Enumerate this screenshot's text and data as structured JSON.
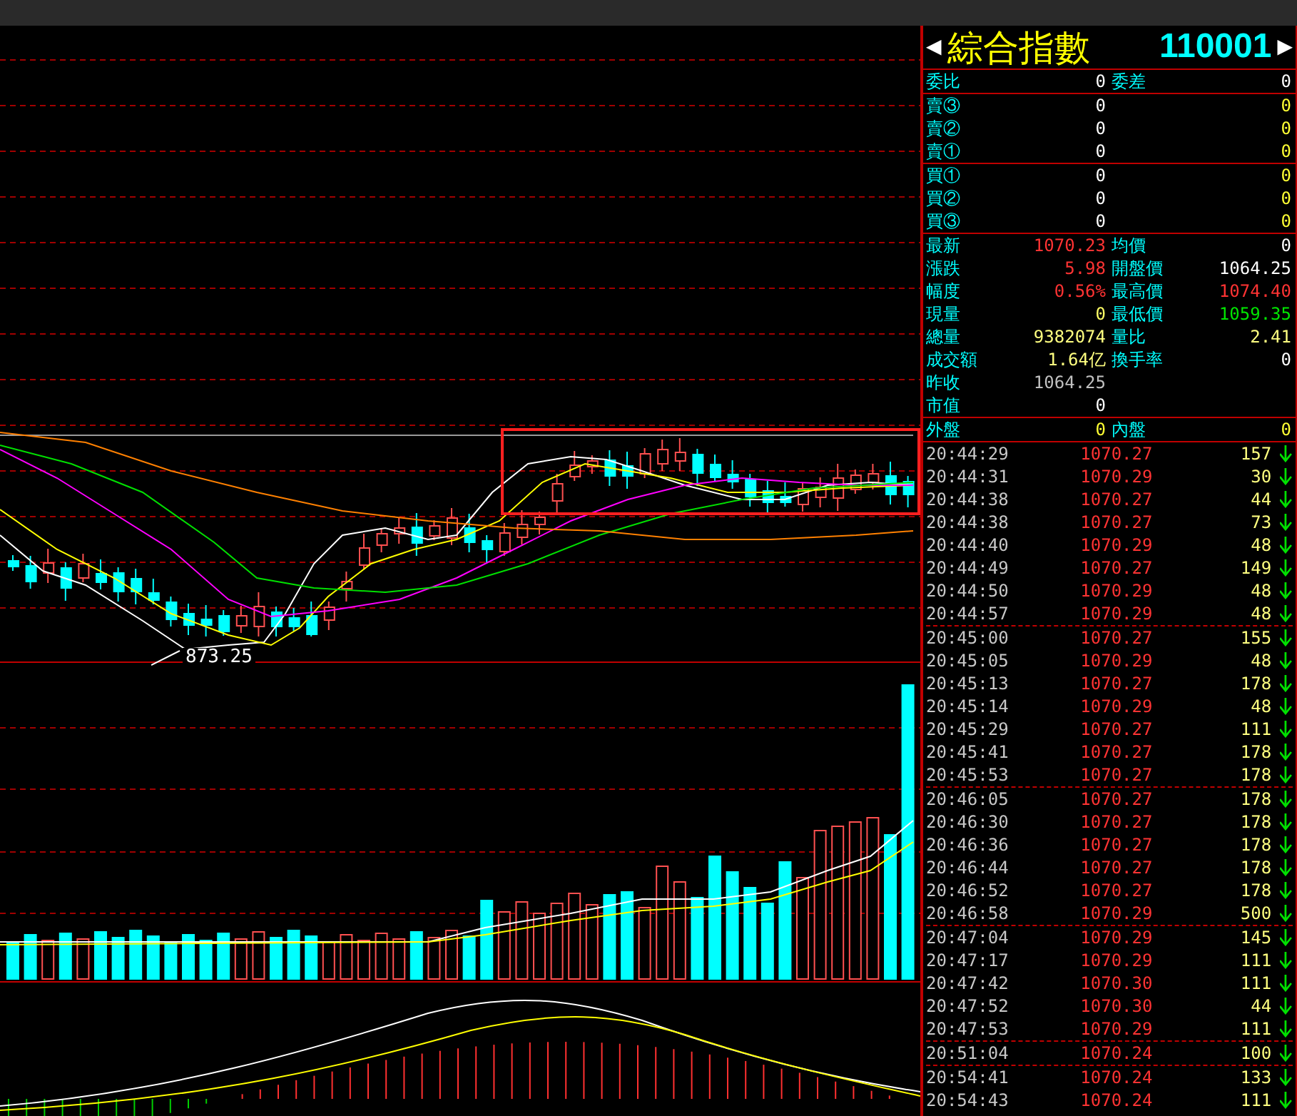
{
  "chart": {
    "low_label": "873.25"
  },
  "quote": {
    "prev_glyph": "◀",
    "title": "綜合指數",
    "code": "110001",
    "next_glyph": "▶"
  },
  "ratio_row": {
    "label": "委比",
    "value": "0",
    "label2": "委差",
    "value2": "0"
  },
  "sell_levels": [
    {
      "label": "賣③",
      "volume": "0",
      "value2": "0"
    },
    {
      "label": "賣②",
      "volume": "0",
      "value2": "0"
    },
    {
      "label": "賣①",
      "volume": "0",
      "value2": "0"
    }
  ],
  "buy_levels": [
    {
      "label": "買①",
      "volume": "0",
      "value2": "0"
    },
    {
      "label": "買②",
      "volume": "0",
      "value2": "0"
    },
    {
      "label": "買③",
      "volume": "0",
      "value2": "0"
    }
  ],
  "stats": [
    {
      "cells": [
        {
          "label": "最新",
          "value": "1070.23",
          "color": "#ff3333"
        },
        {
          "label": "均價",
          "value": "0",
          "color": "#ffffff"
        }
      ]
    },
    {
      "cells": [
        {
          "label": "漲跌",
          "value": "5.98",
          "color": "#ff3333"
        },
        {
          "label": "開盤價",
          "value": "1064.25",
          "color": "#ffffff"
        }
      ]
    },
    {
      "cells": [
        {
          "label": "幅度",
          "value": "0.56%",
          "color": "#ff3333"
        },
        {
          "label": "最高價",
          "value": "1074.40",
          "color": "#ff3333"
        }
      ]
    },
    {
      "cells": [
        {
          "label": "現量",
          "value": "0",
          "color": "#ffff66"
        },
        {
          "label": "最低價",
          "value": "1059.35",
          "color": "#00e600"
        }
      ]
    },
    {
      "cells": [
        {
          "label": "總量",
          "value": "9382074",
          "color": "#ffff80"
        },
        {
          "label": "量比",
          "value": "2.41",
          "color": "#ffff80"
        }
      ]
    },
    {
      "cells": [
        {
          "label": "成交額",
          "value": "1.64亿",
          "color": "#ffff80"
        },
        {
          "label": "換手率",
          "value": "0",
          "color": "#ffffff"
        }
      ]
    },
    {
      "cells": [
        {
          "label": "昨收",
          "value": "1064.25",
          "color": "#c0c0c0"
        }
      ]
    },
    {
      "cells": [
        {
          "label": "市值",
          "value": "0",
          "color": "#ffffff"
        }
      ]
    }
  ],
  "outer_inner": {
    "label": "外盤",
    "value": "0",
    "label2": "內盤",
    "value2": "0"
  },
  "trade_groups": [
    {
      "trades": [
        {
          "time": "20:44:29",
          "price": "1070.27",
          "volume": "157",
          "kind": "sell"
        },
        {
          "time": "20:44:31",
          "price": "1070.29",
          "volume": "30",
          "kind": "sell"
        },
        {
          "time": "20:44:38",
          "price": "1070.27",
          "volume": "44",
          "kind": "sell"
        },
        {
          "time": "20:44:38",
          "price": "1070.27",
          "volume": "73",
          "kind": "sell"
        },
        {
          "time": "20:44:40",
          "price": "1070.29",
          "volume": "48",
          "kind": "sell"
        },
        {
          "time": "20:44:49",
          "price": "1070.27",
          "volume": "149",
          "kind": "sell"
        },
        {
          "time": "20:44:50",
          "price": "1070.29",
          "volume": "48",
          "kind": "sell"
        },
        {
          "time": "20:44:57",
          "price": "1070.29",
          "volume": "48",
          "kind": "sell"
        }
      ]
    },
    {
      "trades": [
        {
          "time": "20:45:00",
          "price": "1070.27",
          "volume": "155",
          "kind": "sell"
        },
        {
          "time": "20:45:05",
          "price": "1070.29",
          "volume": "48",
          "kind": "sell"
        },
        {
          "time": "20:45:13",
          "price": "1070.27",
          "volume": "178",
          "kind": "sell"
        },
        {
          "time": "20:45:14",
          "price": "1070.29",
          "volume": "48",
          "kind": "sell"
        },
        {
          "time": "20:45:29",
          "price": "1070.27",
          "volume": "111",
          "kind": "sell"
        },
        {
          "time": "20:45:41",
          "price": "1070.27",
          "volume": "178",
          "kind": "sell"
        },
        {
          "time": "20:45:53",
          "price": "1070.27",
          "volume": "178",
          "kind": "sell"
        }
      ]
    },
    {
      "trades": [
        {
          "time": "20:46:05",
          "price": "1070.27",
          "volume": "178",
          "kind": "sell"
        },
        {
          "time": "20:46:30",
          "price": "1070.27",
          "volume": "178",
          "kind": "sell"
        },
        {
          "time": "20:46:36",
          "price": "1070.27",
          "volume": "178",
          "kind": "sell"
        },
        {
          "time": "20:46:44",
          "price": "1070.27",
          "volume": "178",
          "kind": "sell"
        },
        {
          "time": "20:46:52",
          "price": "1070.27",
          "volume": "178",
          "kind": "sell"
        },
        {
          "time": "20:46:58",
          "price": "1070.29",
          "volume": "500",
          "kind": "sell"
        }
      ]
    },
    {
      "trades": [
        {
          "time": "20:47:04",
          "price": "1070.29",
          "volume": "145",
          "kind": "sell"
        },
        {
          "time": "20:47:17",
          "price": "1070.29",
          "volume": "111",
          "kind": "sell"
        },
        {
          "time": "20:47:42",
          "price": "1070.30",
          "volume": "111",
          "kind": "sell"
        },
        {
          "time": "20:47:52",
          "price": "1070.30",
          "volume": "44",
          "kind": "sell"
        },
        {
          "time": "20:47:53",
          "price": "1070.29",
          "volume": "111",
          "kind": "sell"
        }
      ]
    },
    {
      "trades": [
        {
          "time": "20:51:04",
          "price": "1070.24",
          "volume": "100",
          "kind": "sell"
        }
      ]
    },
    {
      "trades": [
        {
          "time": "20:54:41",
          "price": "1070.24",
          "volume": "133",
          "kind": "sell"
        },
        {
          "time": "20:54:43",
          "price": "1070.24",
          "volume": "111",
          "kind": "sell"
        }
      ]
    }
  ]
}
